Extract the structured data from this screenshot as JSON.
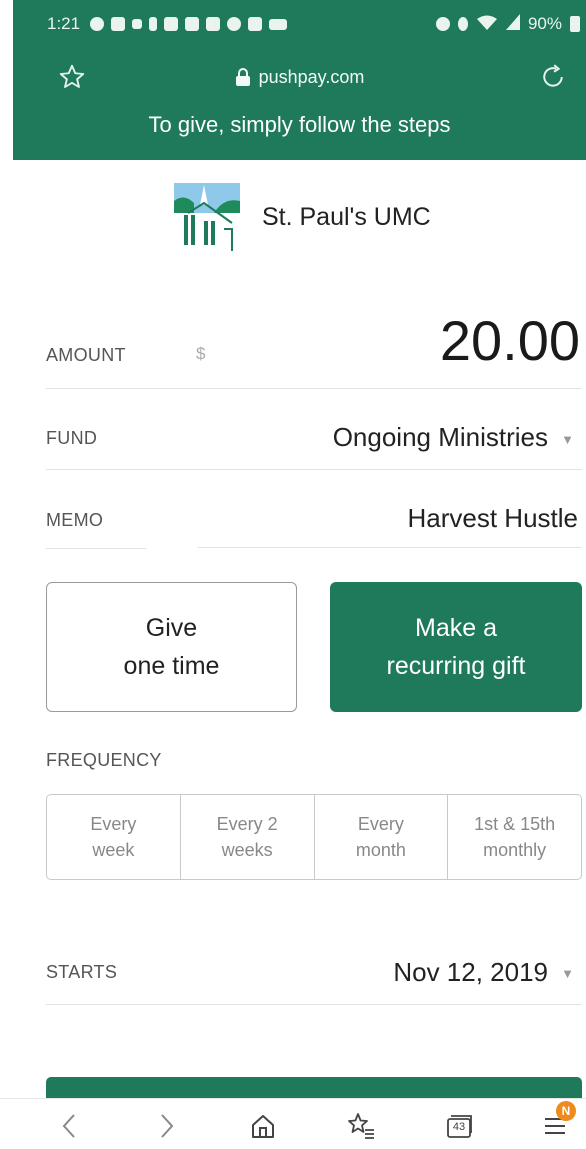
{
  "status_bar": {
    "time": "1:21",
    "battery": "90%",
    "icons": [
      "eye-icon",
      "messages-icon",
      "grid-icon",
      "usb-icon",
      "mail-icon",
      "mail-icon",
      "mail-icon",
      "eye-icon",
      "linkedin-icon",
      "video-icon",
      "alarm-icon",
      "bluetooth-icon",
      "wifi-icon",
      "signal-icon",
      "battery-icon"
    ]
  },
  "browser": {
    "url": "pushpay.com",
    "tagline": "To give, simply follow the steps"
  },
  "org": {
    "name": "St. Paul's UMC"
  },
  "form": {
    "amount_label": "AMOUNT",
    "currency_symbol": "$",
    "amount_value": "20.00",
    "fund_label": "FUND",
    "fund_value": "Ongoing Ministries",
    "memo_label": "MEMO",
    "memo_value": "Harvest Hustle",
    "give_once_label": "Give\none time",
    "recurring_label": "Make a\nrecurring gift",
    "frequency_label": "FREQUENCY",
    "frequency_options": [
      "Every\nweek",
      "Every 2\nweeks",
      "Every\nmonth",
      "1st & 15th\nmonthly"
    ],
    "starts_label": "STARTS",
    "starts_value": "Nov 12, 2019"
  },
  "bottom_nav": {
    "tabs_count": "43",
    "menu_badge": "N"
  },
  "colors": {
    "brand_green": "#1f7a5c",
    "badge_orange": "#f08a1c"
  }
}
